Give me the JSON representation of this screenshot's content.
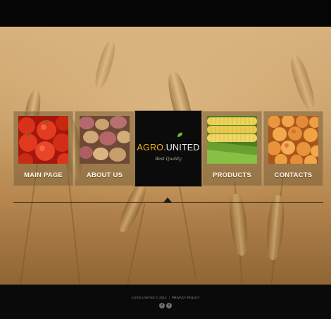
{
  "brand": {
    "logo_part1": "AGRO.",
    "logo_part2": "UNITED",
    "tagline": "Best Quality",
    "accent_color": "#f1b41a"
  },
  "menu": {
    "items": [
      {
        "label": "MAIN PAGE",
        "image": "tomatoes"
      },
      {
        "label": "ABOUT US",
        "image": "potatoes"
      },
      {
        "label": "PRODUCTS",
        "image": "corn"
      },
      {
        "label": "CONTACTS",
        "image": "apricots"
      }
    ]
  },
  "footer": {
    "copyright": "AGRO.UNITED © 2012",
    "separator": "|",
    "privacy_link": "PRIVACY POLICY",
    "social": [
      {
        "icon": "facebook-icon",
        "glyph": "f"
      },
      {
        "icon": "twitter-icon",
        "glyph": "t"
      }
    ]
  },
  "colors": {
    "header_bg": "#050505",
    "footer_bg": "#0a0a0a",
    "hero_wheat": "#caa06a"
  }
}
